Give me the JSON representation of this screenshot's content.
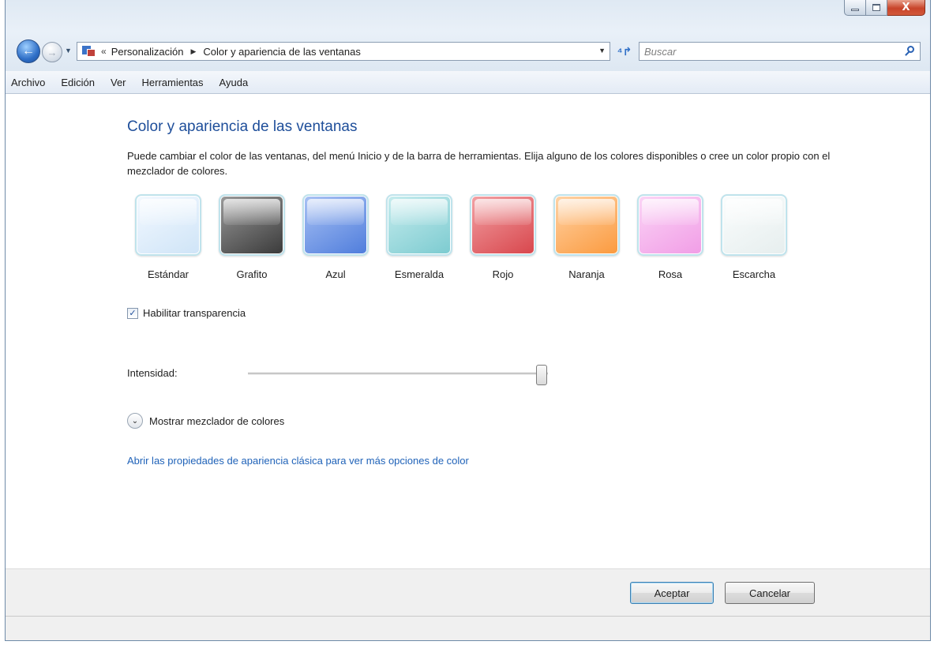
{
  "window": {
    "close_glyph": "X"
  },
  "nav": {
    "back_glyph": "←",
    "forward_glyph": "→",
    "address_separator": "«",
    "breadcrumbs": [
      "Personalización",
      "Color y apariencia de las ventanas"
    ],
    "breadcrumb_arrow": "▶",
    "dropdown_glyph": "▼",
    "refresh_glyph": "⁴↱",
    "search_placeholder": "Buscar"
  },
  "menu": [
    "Archivo",
    "Edición",
    "Ver",
    "Herramientas",
    "Ayuda"
  ],
  "content": {
    "title": "Color y apariencia de las ventanas",
    "description": "Puede cambiar el color de las ventanas, del menú Inicio y de la barra de herramientas. Elija alguno de los colores disponibles o cree un color propio con el mezclador de colores.",
    "swatches": [
      {
        "label": "Estándar",
        "color_top": "#f3f9ff",
        "color_bottom": "#cfe4f7"
      },
      {
        "label": "Grafito",
        "color_top": "#9a9a9a",
        "color_bottom": "#3a3a3a"
      },
      {
        "label": "Azul",
        "color_top": "#a9c2f4",
        "color_bottom": "#4f7ddc"
      },
      {
        "label": "Esmeralda",
        "color_top": "#c6ecee",
        "color_bottom": "#7ccbd0"
      },
      {
        "label": "Rojo",
        "color_top": "#f2a1a4",
        "color_bottom": "#d8464c"
      },
      {
        "label": "Naranja",
        "color_top": "#ffd3a6",
        "color_bottom": "#fb9a3e"
      },
      {
        "label": "Rosa",
        "color_top": "#fbd5f6",
        "color_bottom": "#f19de6"
      },
      {
        "label": "Escarcha",
        "color_top": "#fbfdfd",
        "color_bottom": "#e6eeee"
      }
    ],
    "transparency": {
      "label": "Habilitar transparencia",
      "checked": true,
      "check_glyph": "✓"
    },
    "intensity": {
      "label": "Intensidad:",
      "value_fraction": 0.98
    },
    "mixer": {
      "label": "Mostrar mezclador de colores",
      "chevron_glyph": "⌄"
    },
    "classic_link": "Abrir las propiedades de apariencia clásica para ver más opciones de color"
  },
  "buttons": {
    "ok": "Aceptar",
    "cancel": "Cancelar"
  }
}
